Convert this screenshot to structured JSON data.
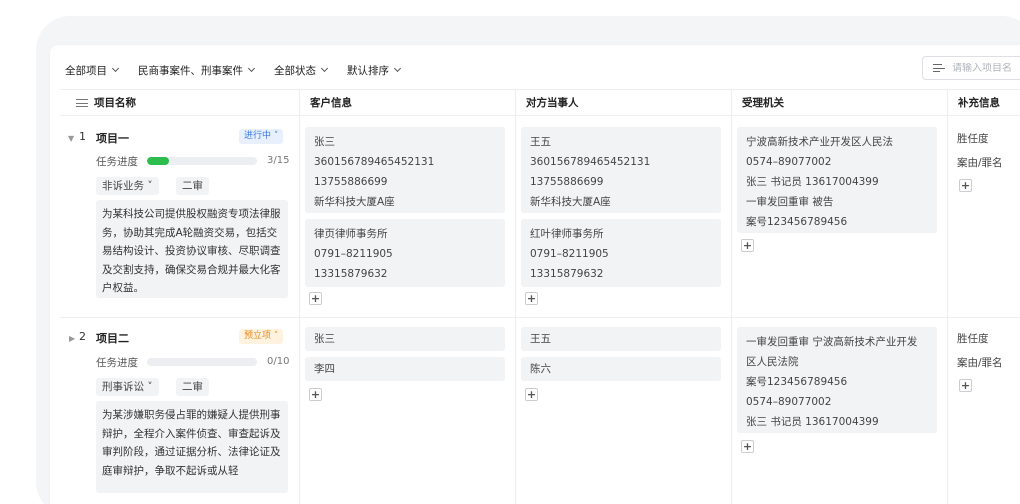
{
  "filters": {
    "project": "全部项目",
    "case_type": "民商事案件、刑事案件",
    "status": "全部状态",
    "sort": "默认排序"
  },
  "search": {
    "placeholder": "请输入项目名"
  },
  "columns": {
    "name": "项目名称",
    "client": "客户信息",
    "opponent": "对方当事人",
    "authority": "受理机关",
    "extra": "补充信息"
  },
  "rows": [
    {
      "num": "1",
      "name": "项目一",
      "status": "进行中",
      "progress_label": "任务进度",
      "progress_count": "3/15",
      "progress_fraction": 0.2,
      "business": "非诉业务",
      "stage": "二审",
      "description": "为某科技公司提供股权融资专项法律服务，协助其完成A轮融资交易，包括交易结构设计、投资协议审核、尽职调查及交割支持，确保交易合规并最大化客户权益。",
      "client": [
        [
          "张三",
          "360156789465452131",
          "13755886699",
          "新华科技大厦A座"
        ],
        [
          "律页律师事务所",
          "0791–8211905",
          "13315879632"
        ]
      ],
      "opponent": [
        [
          "王五",
          "360156789465452131",
          "13755886699",
          "新华科技大厦A座"
        ],
        [
          "红叶律师事务所",
          "0791–8211905",
          "13315879632"
        ]
      ],
      "authority": [
        [
          "宁波高新技术产业开发区人民法",
          "0574–89077002",
          "张三 书记员 13617004399",
          "一审发回重审 被告",
          "案号123456789456"
        ]
      ],
      "extra": [
        "胜任度",
        "案由/罪名"
      ]
    },
    {
      "num": "2",
      "name": "项目二",
      "status": "预立项",
      "progress_label": "任务进度",
      "progress_count": "0/10",
      "progress_fraction": 0,
      "business": "刑事诉讼",
      "stage": "二审",
      "description": "为某涉嫌职务侵占罪的嫌疑人提供刑事辩护，全程介入案件侦查、审查起诉及审判阶段，通过证据分析、法律论证及庭审辩护，争取不起诉或从轻",
      "client": [
        [
          "张三"
        ],
        [
          "李四"
        ]
      ],
      "opponent": [
        [
          "王五"
        ],
        [
          "陈六"
        ]
      ],
      "authority": [
        [
          "一审发回重审 宁波高新技术产业开发",
          "区人民法院",
          "案号123456789456",
          "0574–89077002",
          "张三 书记员 13617004399"
        ]
      ],
      "extra": [
        "胜任度",
        "案由/罪名"
      ]
    }
  ]
}
